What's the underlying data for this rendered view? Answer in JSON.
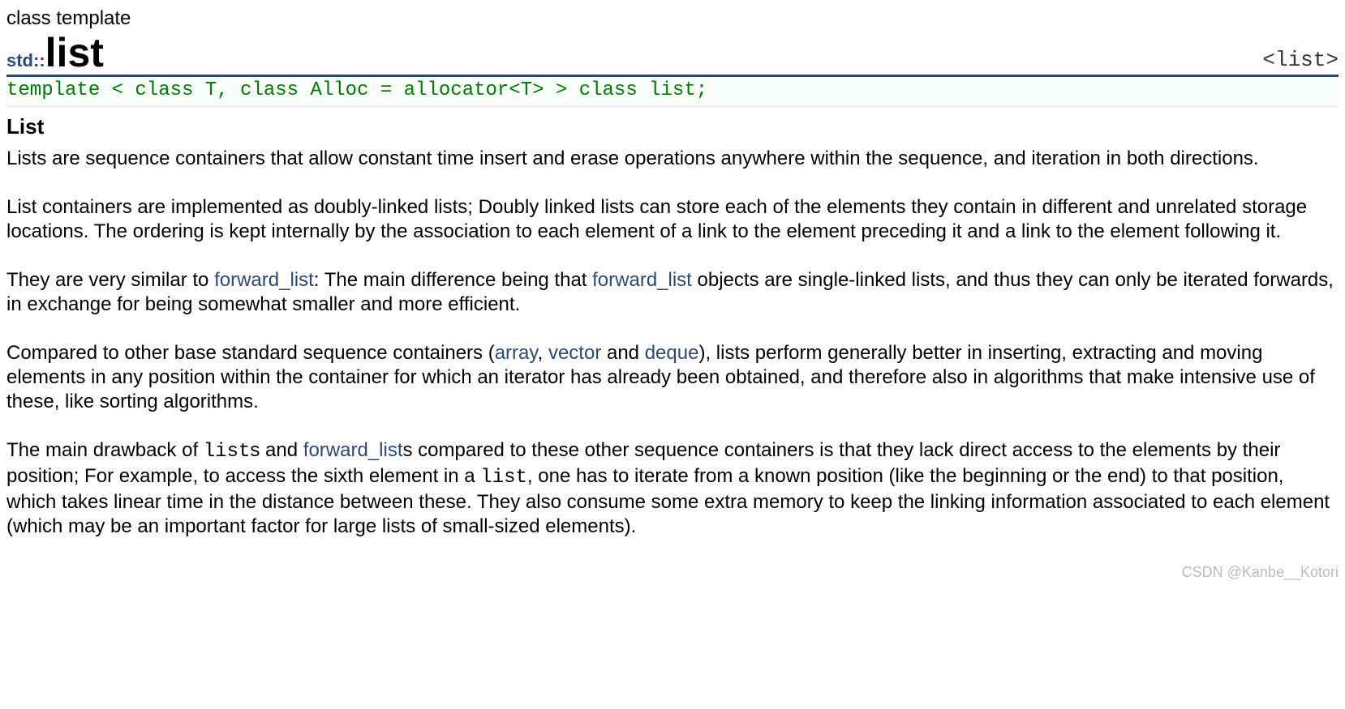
{
  "header": {
    "supertitle": "class template",
    "namespace": "std::",
    "class_name": "list",
    "right_label": "<list>"
  },
  "signature": "template < class T, class Alloc = allocator<T> > class list;",
  "section_title": "List",
  "p1": "Lists are sequence containers that allow constant time insert and erase operations anywhere within the sequence, and iteration in both directions.",
  "p2": "List containers are implemented as doubly-linked lists; Doubly linked lists can store each of the elements they contain in different and unrelated storage locations. The ordering is kept internally by the association to each element of a link to the element preceding it and a link to the element following it.",
  "p3": {
    "a": "They are very similar to ",
    "link1": "forward_list",
    "b": ": The main difference being that ",
    "link2": "forward_list",
    "c": " objects are single-linked lists, and thus they can only be iterated forwards, in exchange for being somewhat smaller and more efficient."
  },
  "p4": {
    "a": "Compared to other base standard sequence containers (",
    "link1": "array",
    "b": ", ",
    "link2": "vector",
    "c": " and ",
    "link3": "deque",
    "d": "), lists perform generally better in inserting, extracting and moving elements in any position within the container for which an iterator has already been obtained, and therefore also in algorithms that make intensive use of these, like sorting algorithms."
  },
  "p5": {
    "a": "The main drawback of ",
    "mono1": "list",
    "b": "s and ",
    "link1": "forward_list",
    "c": "s compared to these other sequence containers is that they lack direct access to the elements by their position; For example, to access the sixth element in a ",
    "mono2": "list",
    "d": ", one has to iterate from a known position (like the beginning or the end) to that position, which takes linear time in the distance between these. They also consume some extra memory to keep the linking information associated to each element (which may be an important factor for large lists of small-sized elements)."
  },
  "watermark": "CSDN @Kanbe__Kotori"
}
